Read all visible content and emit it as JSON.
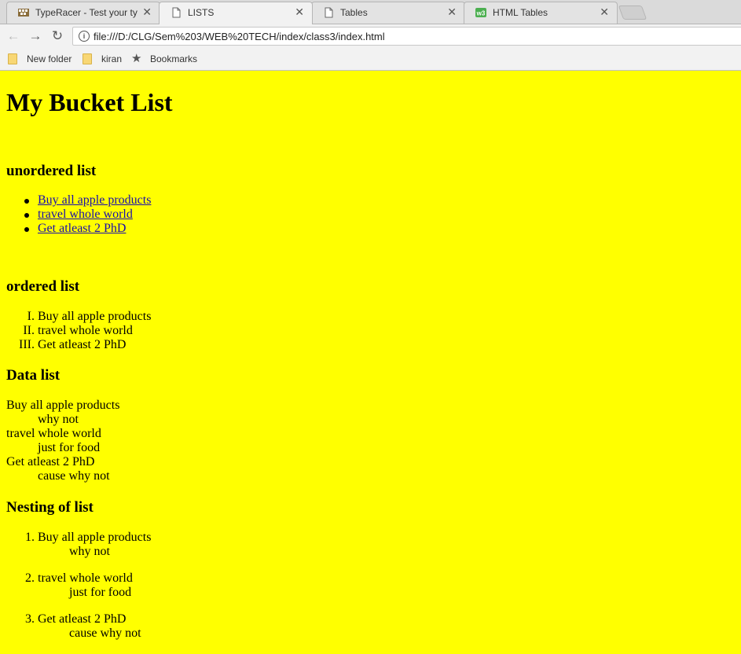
{
  "tabs": [
    {
      "title": "TypeRacer - Test your typ",
      "icon": "typeracer-icon"
    },
    {
      "title": "LISTS",
      "icon": "page-icon"
    },
    {
      "title": "Tables",
      "icon": "page-icon"
    },
    {
      "title": "HTML Tables",
      "icon": "w3-icon"
    }
  ],
  "omnibox": {
    "url": "file:///D:/CLG/Sem%203/WEB%20TECH/index/class3/index.html"
  },
  "bookmarks": [
    {
      "label": "New folder",
      "icon": "folder-icon"
    },
    {
      "label": "kiran",
      "icon": "folder-icon"
    },
    {
      "label": "Bookmarks",
      "icon": "star-icon"
    }
  ],
  "page": {
    "title": "My Bucket List",
    "unordered": {
      "heading": "unordered list",
      "items": [
        "Buy all apple products",
        "travel whole world",
        "Get atleast 2 PhD"
      ]
    },
    "ordered": {
      "heading": "ordered list",
      "markers": [
        "I.",
        "II.",
        "III."
      ],
      "items": [
        "Buy all apple products",
        "travel whole world",
        "Get atleast 2 PhD"
      ]
    },
    "datalist": {
      "heading": "Data list",
      "terms": [
        "Buy all apple products",
        "travel whole world",
        "Get atleast 2 PhD"
      ],
      "defs": [
        "why not",
        "just for food",
        "cause why not"
      ]
    },
    "nesting": {
      "heading": "Nesting of list",
      "markers": [
        "1.",
        "2.",
        "3."
      ],
      "items": [
        "Buy all apple products",
        "travel whole world",
        "Get atleast 2 PhD"
      ],
      "subs": [
        "why not",
        "just for food",
        "cause why not"
      ]
    }
  },
  "colors": {
    "page_background": "#ffff00",
    "link": "#1a0dab"
  }
}
